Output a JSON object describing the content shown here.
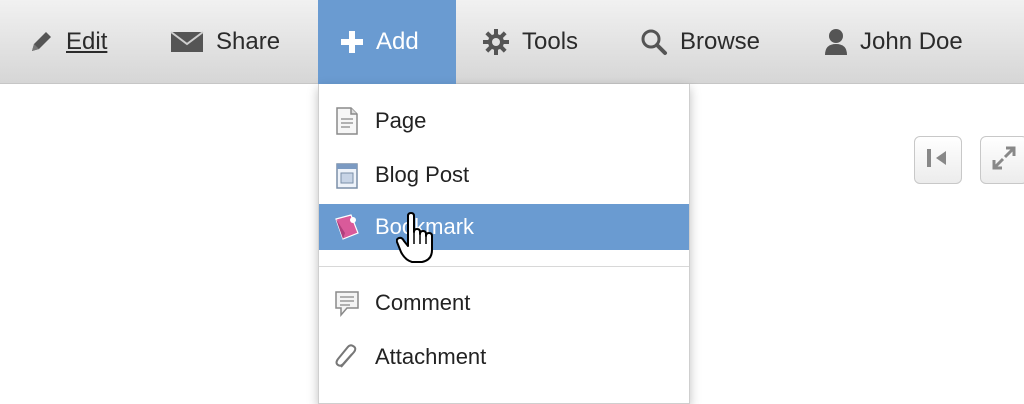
{
  "toolbar": {
    "items": [
      {
        "label": "Edit",
        "icon": "pencil-icon"
      },
      {
        "label": "Share",
        "icon": "envelope-icon"
      },
      {
        "label": "Add",
        "icon": "plus-icon"
      },
      {
        "label": "Tools",
        "icon": "gear-icon"
      },
      {
        "label": "Browse",
        "icon": "search-icon"
      },
      {
        "label": "John Doe",
        "icon": "user-icon"
      }
    ]
  },
  "add_menu": {
    "items": [
      {
        "label": "Page",
        "icon": "page-icon"
      },
      {
        "label": "Blog Post",
        "icon": "blog-post-icon"
      },
      {
        "label": "Bookmark",
        "icon": "bookmark-icon",
        "highlighted": true
      },
      {
        "label": "Comment",
        "icon": "comment-icon"
      },
      {
        "label": "Attachment",
        "icon": "paperclip-icon"
      }
    ]
  },
  "side_buttons": [
    {
      "icon": "collapse-left-icon"
    },
    {
      "icon": "expand-icon"
    }
  ],
  "colors": {
    "accent": "#6a9bd1",
    "toolbar_top": "#f1f1f1",
    "toolbar_bottom": "#d6d6d6"
  }
}
